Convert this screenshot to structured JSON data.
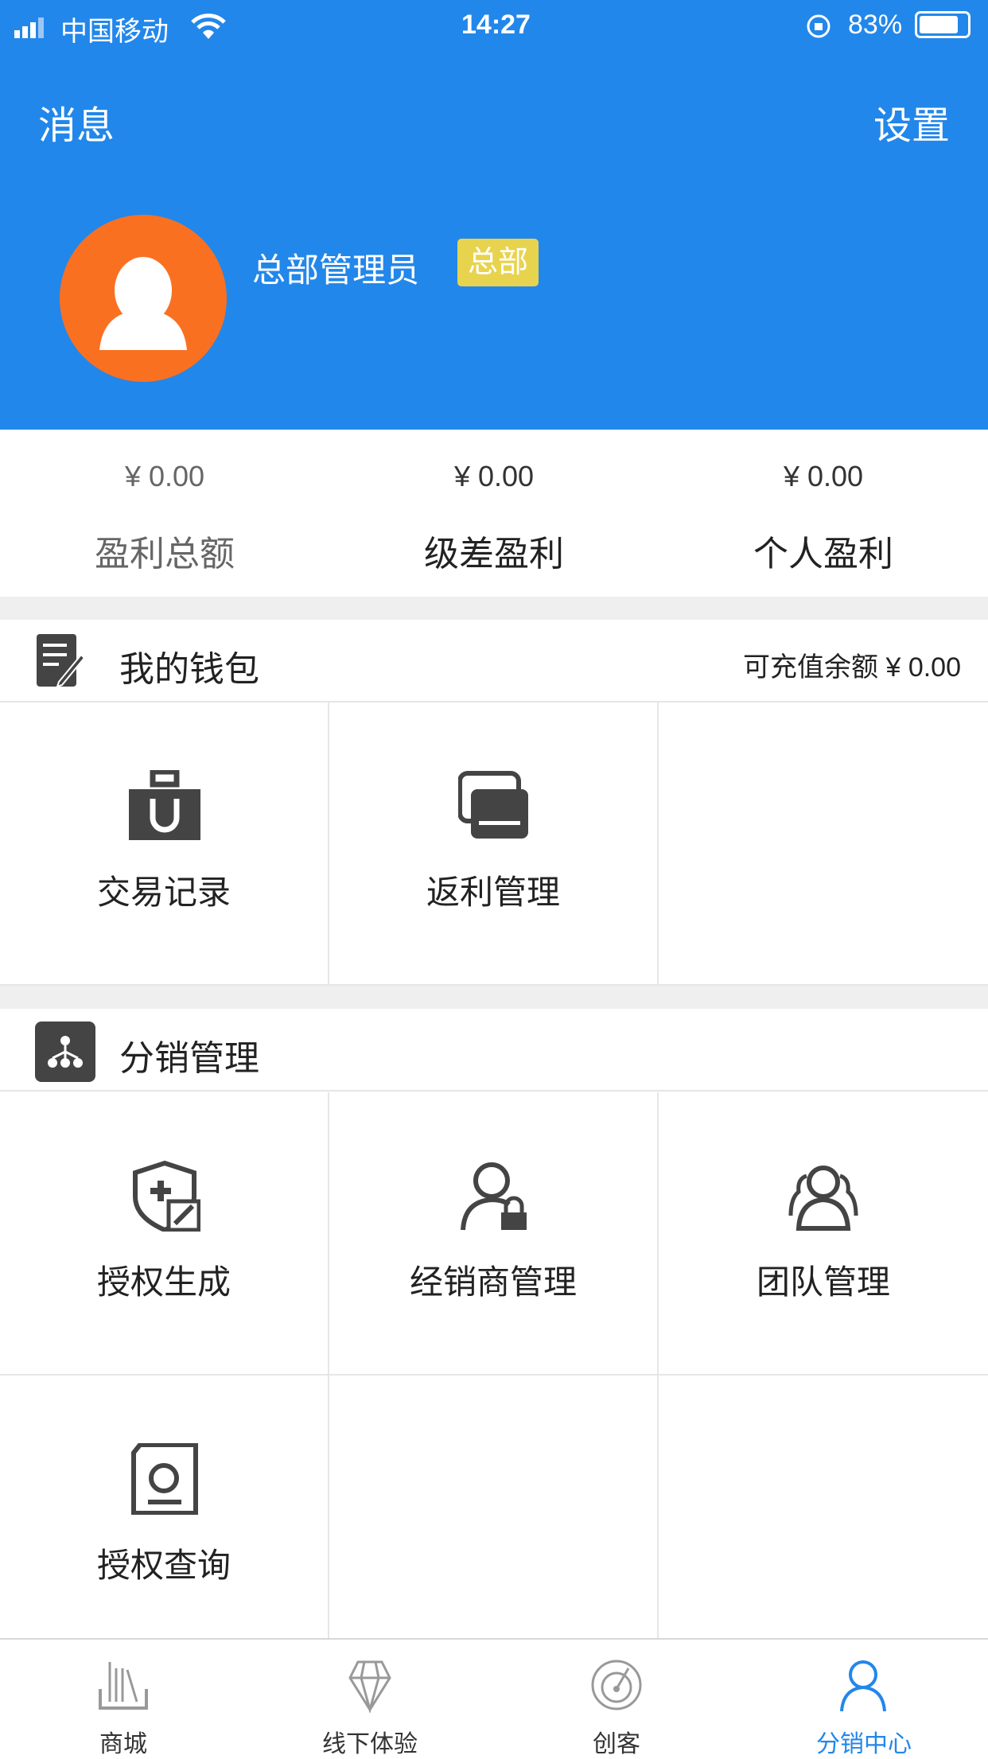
{
  "status_bar": {
    "carrier": "中国移动",
    "time": "14:27",
    "battery": "83%",
    "battery_level": 0.83
  },
  "header": {
    "left": "消息",
    "right": "设置",
    "user_name": "总部管理员",
    "badge": "总部",
    "colors": {
      "bg": "#2287ea",
      "avatar": "#fa7021",
      "badge": "#e8d34f"
    }
  },
  "stats": [
    {
      "value": "¥ 0.00",
      "label": "盈利总额"
    },
    {
      "value": "¥ 0.00",
      "label": "级差盈利"
    },
    {
      "value": "¥ 0.00",
      "label": "个人盈利"
    }
  ],
  "wallet": {
    "title": "我的钱包",
    "balance": "可充值余额 ¥ 0.00",
    "items": [
      {
        "label": "交易记录",
        "icon": "shopping-bag-icon"
      },
      {
        "label": "返利管理",
        "icon": "cards-icon"
      }
    ]
  },
  "distribution": {
    "title": "分销管理",
    "items": [
      {
        "label": "授权生成",
        "icon": "shield-plus-icon"
      },
      {
        "label": "经销商管理",
        "icon": "user-lock-icon"
      },
      {
        "label": "团队管理",
        "icon": "team-icon"
      },
      {
        "label": "授权查询",
        "icon": "certificate-search-icon"
      }
    ]
  },
  "tabbar": {
    "active": 3,
    "active_color": "#2287ea",
    "items": [
      {
        "label": "商城",
        "icon": "books-icon"
      },
      {
        "label": "线下体验",
        "icon": "diamond-icon"
      },
      {
        "label": "创客",
        "icon": "radar-icon"
      },
      {
        "label": "分销中心",
        "icon": "user-icon"
      }
    ]
  }
}
